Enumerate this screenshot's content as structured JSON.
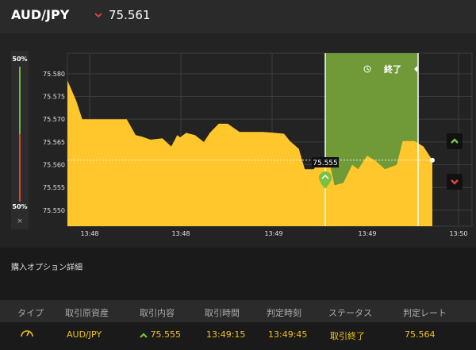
{
  "header": {
    "pair": "AUD/JPY",
    "current_rate": "75.561",
    "direction": "down",
    "down_color": "#e0483b"
  },
  "gauge": {
    "up_pct": "50%",
    "down_pct": "50%",
    "close": "×",
    "up_color": "#6fb83a",
    "down_color": "#d24b2f"
  },
  "chart": {
    "y_ticks": [
      "75.580",
      "75.575",
      "75.570",
      "75.565",
      "75.560",
      "75.555",
      "75.550"
    ],
    "x_ticks": [
      "13:48",
      "13:48",
      "13:49",
      "13:49",
      "13:50"
    ],
    "entry_label": "75.555",
    "end_label": "終了",
    "fill_color": "#ffc72c",
    "zone_color": "#6f9a37"
  },
  "chart_data": {
    "type": "area",
    "x": [
      "13:47:45",
      "13:47:47",
      "13:47:48",
      "13:47:50",
      "13:47:55",
      "13:48:00",
      "13:48:05",
      "13:48:08",
      "13:48:10",
      "13:48:13",
      "13:48:17",
      "13:48:20",
      "13:48:22",
      "13:48:23",
      "13:48:25",
      "13:48:28",
      "13:48:31",
      "13:48:33",
      "13:48:36",
      "13:48:39",
      "13:48:43",
      "13:48:48",
      "13:48:51",
      "13:48:55",
      "13:48:58",
      "13:49:00",
      "13:49:03",
      "13:49:05",
      "13:49:08",
      "13:49:10",
      "13:49:13",
      "13:49:15",
      "13:49:18",
      "13:49:21",
      "13:49:23",
      "13:49:26",
      "13:49:29",
      "13:49:32",
      "13:49:36",
      "13:49:38",
      "13:49:42",
      "13:49:45",
      "13:49:48"
    ],
    "y": [
      75.5785,
      75.5755,
      75.574,
      75.57,
      75.57,
      75.57,
      75.57,
      75.5665,
      75.5662,
      75.5655,
      75.5658,
      75.564,
      75.5665,
      75.566,
      75.567,
      75.5665,
      75.565,
      75.567,
      75.569,
      75.569,
      75.5672,
      75.5672,
      75.5672,
      75.567,
      75.5668,
      75.5652,
      75.5635,
      75.559,
      75.559,
      75.561,
      75.5615,
      75.5555,
      75.556,
      75.56,
      75.559,
      75.562,
      75.5608,
      75.559,
      75.56,
      75.5652,
      75.5652,
      75.564,
      75.561
    ],
    "entry": 75.555,
    "current": 75.561,
    "ylim": [
      75.5465,
      75.5845
    ],
    "grid": true
  },
  "details": {
    "title": "購入オプション詳細",
    "columns": [
      "タイプ",
      "取引原資産",
      "取引内容",
      "取引時間",
      "判定時刻",
      "ステータス",
      "判定レート"
    ],
    "row": {
      "type_icon": "gauge-icon",
      "asset": "AUD/JPY",
      "content": "75.555",
      "trade_time": "13:49:15",
      "judge_time": "13:49:45",
      "status": "取引終了",
      "judge_rate": "75.564"
    }
  }
}
